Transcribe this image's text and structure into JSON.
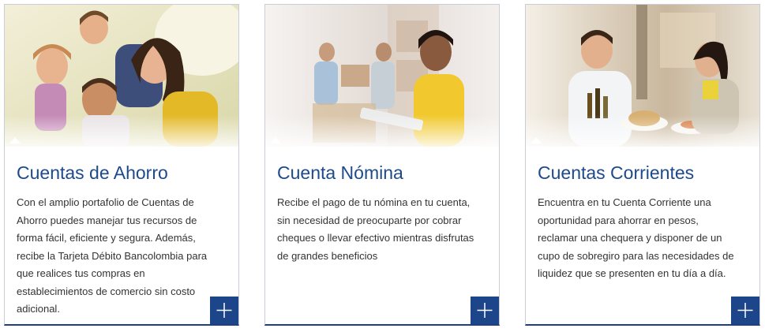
{
  "cards": [
    {
      "title": "Cuentas de Ahorro",
      "description": "Con el amplio portafolio de Cuentas de Ahorro puedes manejar tus recursos de forma fácil, eficiente y segura. Además, recibe la Tarjeta Débito Bancolombia para que realices tus compras en establecimientos de comercio sin costo adicional.",
      "image": "family-photo",
      "button_icon": "plus-icon"
    },
    {
      "title": "Cuenta Nómina",
      "description": "Recibe el pago de tu nómina en tu cuenta, sin necesidad de preocuparte por cobrar cheques o llevar efectivo mientras disfrutas de grandes beneficios",
      "image": "warehouse-worker-photo",
      "button_icon": "plus-icon"
    },
    {
      "title": "Cuentas Corrientes",
      "description": "Encuentra en tu Cuenta Corriente una oportunidad para ahorrar en pesos, reclamar una chequera y disponer de un cupo de sobregiro para las necesidades de liquidez que se presenten en tu día a día.",
      "image": "restaurant-couple-photo",
      "button_icon": "plus-icon"
    }
  ],
  "colors": {
    "title": "#1d4a8a",
    "button": "#1d4589",
    "border": "#c9ced6",
    "text": "#333333"
  }
}
